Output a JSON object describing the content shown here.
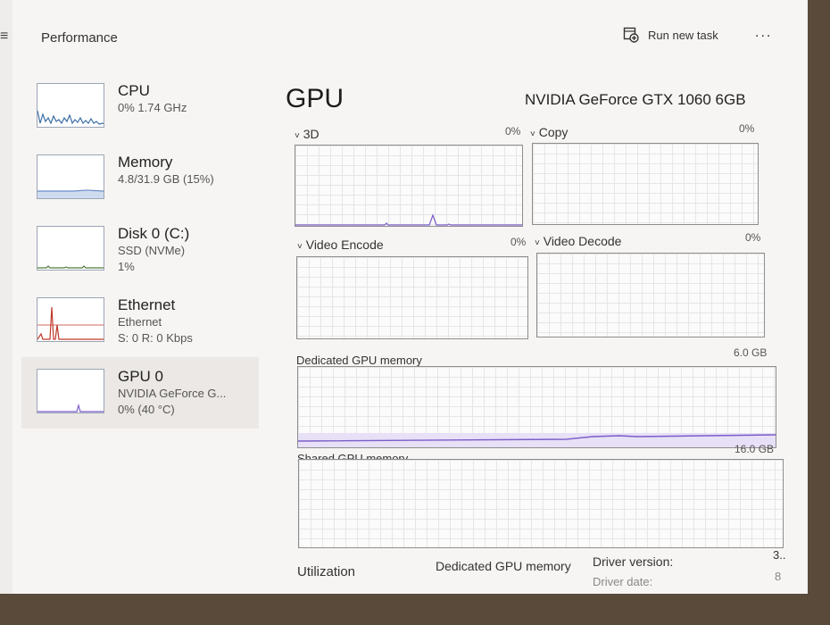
{
  "header": {
    "title": "Performance",
    "run_task_label": "Run new task",
    "more_label": "..."
  },
  "sidebar": {
    "items": [
      {
        "title": "CPU",
        "sub1": "0% 1.74 GHz",
        "sub2": ""
      },
      {
        "title": "Memory",
        "sub1": "4.8/31.9 GB (15%)",
        "sub2": ""
      },
      {
        "title": "Disk 0 (C:)",
        "sub1": "SSD (NVMe)",
        "sub2": "1%"
      },
      {
        "title": "Ethernet",
        "sub1": "Ethernet",
        "sub2": "S: 0 R: 0 Kbps"
      },
      {
        "title": "GPU 0",
        "sub1": "NVIDIA GeForce G...",
        "sub2": "0% (40 °C)"
      }
    ]
  },
  "main": {
    "title": "GPU",
    "model": "NVIDIA GeForce GTX 1060 6GB",
    "engines": [
      {
        "label": "3D",
        "pct": "0%"
      },
      {
        "label": "Copy",
        "pct": "0%"
      },
      {
        "label": "Video Encode",
        "pct": "0%"
      },
      {
        "label": "Video Decode",
        "pct": "0%"
      }
    ],
    "dedicated": {
      "label": "Dedicated GPU memory",
      "max": "6.0 GB"
    },
    "shared": {
      "label": "Shared GPU memory",
      "max": "16.0 GB"
    },
    "stats": {
      "utilization": "Utilization",
      "dedicated_mem": "Dedicated GPU memory",
      "driver_version": "Driver version:",
      "driver_version_val": "3..",
      "driver_date": "Driver date:",
      "driver_date_val": "8"
    }
  },
  "colors": {
    "cpu_line": "#3a6ea5",
    "memory_line": "#6b8fc9",
    "disk_line": "#4f7a3a",
    "ethernet_line": "#c0392b",
    "gpu_line": "#7b5cc9"
  }
}
